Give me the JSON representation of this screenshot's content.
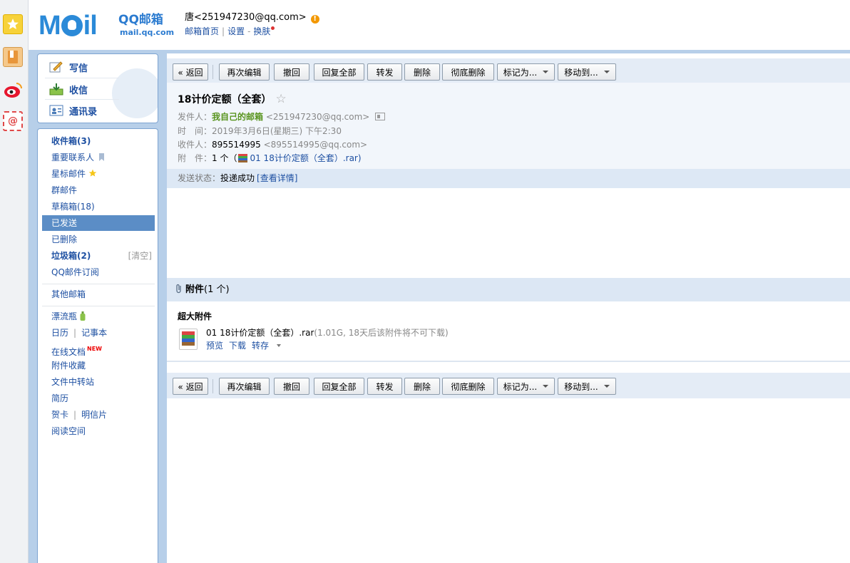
{
  "header": {
    "user": "唐<251947230@qq.com>",
    "links": [
      "邮箱首页",
      "设置",
      "换肤"
    ],
    "separators": [
      "|",
      "-"
    ],
    "logo": {
      "text": "MOil",
      "brand": "QQ邮箱",
      "domain": "mail.qq.com"
    }
  },
  "dock": [
    "favorites-icon",
    "notebook-icon",
    "weibo-icon",
    "mail-at-icon"
  ],
  "compose": {
    "write": "写信",
    "receive": "收信",
    "contacts": "通讯录"
  },
  "folders": {
    "inbox": "收件箱(3)",
    "important": "重要联系人",
    "starred": "星标邮件",
    "group": "群邮件",
    "drafts": "草稿箱(18)",
    "sent": "已发送",
    "deleted": "已删除",
    "spam": "垃圾箱(2)",
    "spam_clear": "[清空]",
    "subscriptions": "QQ邮件订阅",
    "other": "其他邮箱",
    "bottle": "漂流瓶",
    "calendar": "日历",
    "notes": "记事本",
    "docs": "在线文档",
    "docs_badge": "NEW",
    "attachments": "附件收藏",
    "transfer": "文件中转站",
    "resume": "简历",
    "cards": "贺卡",
    "postcards": "明信片",
    "reading": "阅读空间",
    "pipe": "|"
  },
  "toolbar": {
    "back": "« 返回",
    "reedit": "再次编辑",
    "recall": "撤回",
    "reply_all": "回复全部",
    "forward": "转发",
    "delete": "删除",
    "delete_perm": "彻底删除",
    "mark_as": "标记为...",
    "move_to": "移动到..."
  },
  "mail": {
    "subject": "18计价定额（全套）",
    "star": "☆",
    "from_label": "发件人：",
    "from_name": "我自己的邮箱",
    "from_addr": "<251947230@qq.com>",
    "time_label": "时　间：",
    "time_value": "2019年3月6日(星期三) 下午2:30",
    "to_label": "收件人：",
    "to_name": "895514995",
    "to_addr": "<895514995@qq.com>",
    "att_label": "附　件：",
    "att_count": "1 个（",
    "att_file": "01 18计价定额（全套）.rar)",
    "status_label": "发送状态：",
    "status_value": "投递成功",
    "status_link": "[查看详情]"
  },
  "attachments": {
    "title": "附件",
    "count": "(1 个)",
    "big_label": "超大附件",
    "file_name": "01 18计价定额（全套）.rar",
    "file_info": "(1.01G, 18天后该附件将不可下载)",
    "preview": "预览",
    "download": "下载",
    "save_to": "转存"
  }
}
